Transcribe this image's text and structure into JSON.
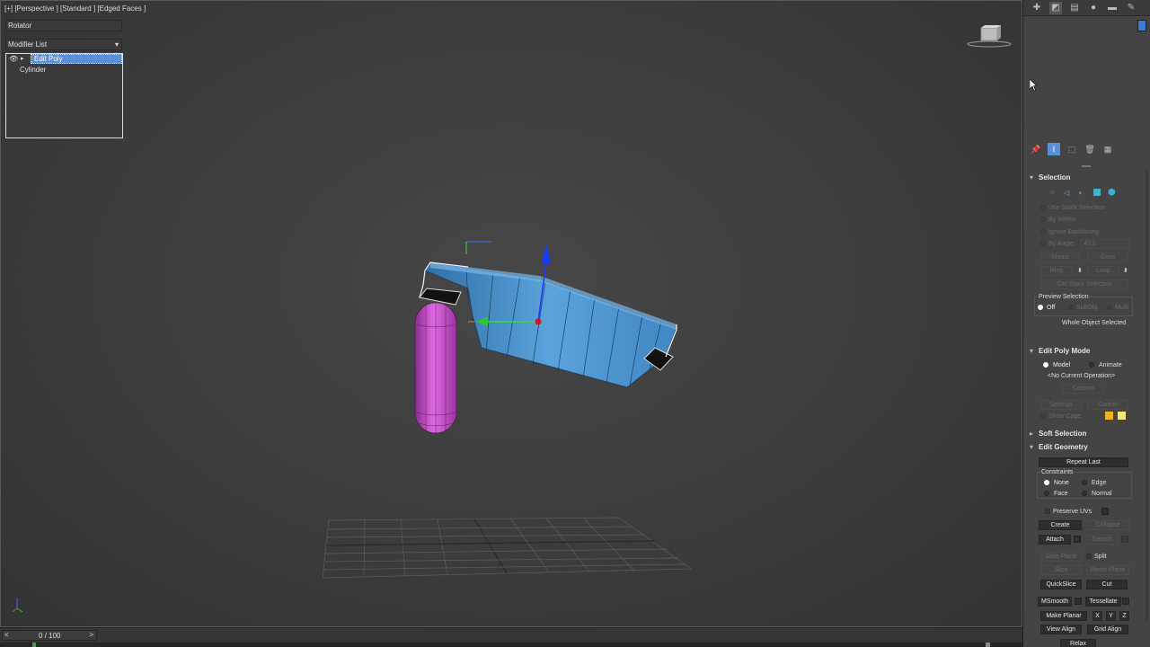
{
  "viewport": {
    "label": "[+] [Perspective ] [Standard ] [Edged Faces ]"
  },
  "timeline": {
    "prev": "<",
    "frame": "0 / 100",
    "next": ">"
  },
  "panel": {
    "tabs": [
      "create-icon",
      "modify-icon",
      "hierarchy-icon",
      "motion-icon",
      "display-icon",
      "utilities-icon"
    ],
    "object_name": "Rotator",
    "object_color": "#3c7fd0",
    "modifier_list": "Modifier List",
    "stack": {
      "edit_poly": "Edit Poly",
      "cylinder": "Cylinder"
    },
    "selection": {
      "title": "Selection",
      "use_stack": "Use Stack Selection",
      "by_vertex": "By Vertex",
      "ignore_backfacing": "Ignore Backfacing",
      "by_angle": "By Angle:",
      "by_angle_value": "45.0",
      "shrink": "Shrink",
      "grow": "Grow",
      "ring": "Ring",
      "loop": "Loop",
      "get_stack_selection": "Get Stack Selection",
      "preview_selection": "Preview Selection",
      "off": "Off",
      "subobj": "SubObj",
      "multi": "Multi",
      "status": "Whole Object Selected"
    },
    "edit_poly_mode": {
      "title": "Edit Poly Mode",
      "model": "Model",
      "animate": "Animate",
      "current_op": "<No Current Operation>",
      "commit": "Commit",
      "settings": "Settings",
      "cancel": "Cancel",
      "show_cage": "Show Cage"
    },
    "soft_selection": {
      "title": "Soft Selection"
    },
    "edit_geometry": {
      "title": "Edit Geometry",
      "repeat_last": "Repeat Last",
      "constraints": "Constraints",
      "none": "None",
      "edge": "Edge",
      "face": "Face",
      "normal": "Normal",
      "preserve_uvs": "Preserve UVs",
      "create": "Create",
      "collapse": "Collapse",
      "attach": "Attach",
      "detach": "Detach",
      "slice_plane": "Slice Plane",
      "split": "Split",
      "slice": "Slice",
      "reset_plane": "Reset Plane",
      "quickslice": "QuickSlice",
      "cut": "Cut",
      "msmooth": "MSmooth",
      "tessellate": "Tessellate",
      "make_planar": "Make Planar",
      "x": "X",
      "y": "Y",
      "z": "Z",
      "view_align": "View Align",
      "grid_align": "Grid Align",
      "relax": "Relax"
    }
  }
}
